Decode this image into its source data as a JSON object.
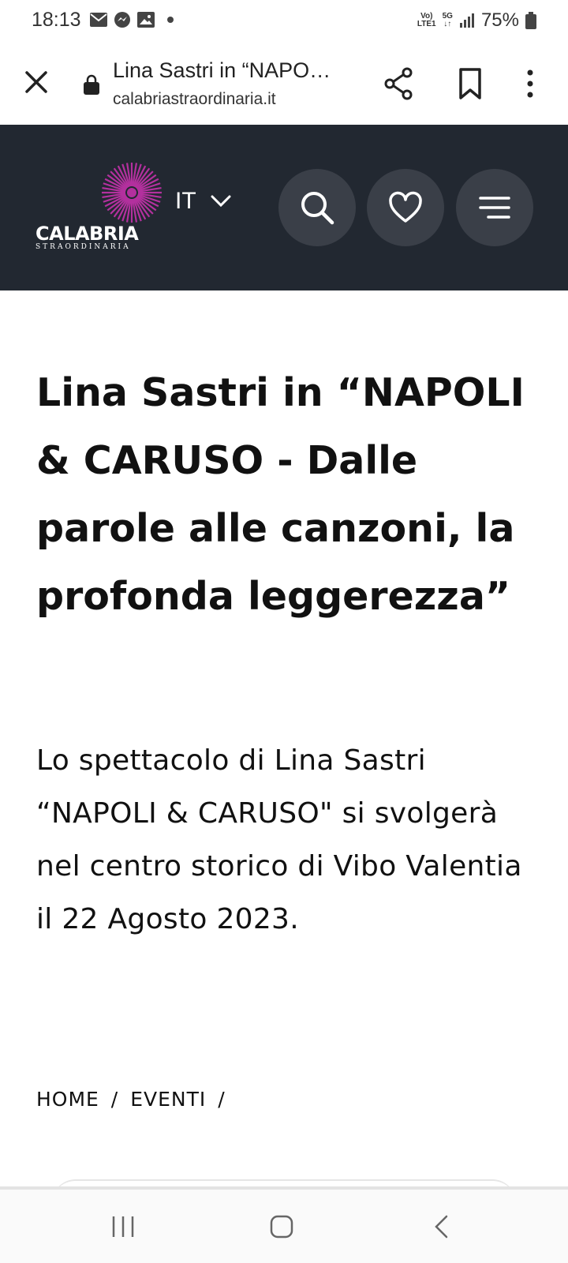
{
  "status_bar": {
    "time": "18:13",
    "network_top": "Vo)",
    "network_bottom": "LTE1",
    "network_5g": "5G",
    "battery": "75%"
  },
  "browser": {
    "title": "Lina Sastri in “NAPO…",
    "url": "calabriastraordinaria.it"
  },
  "site_header": {
    "logo_word": "CALABRIA",
    "logo_sub": "STRAORDINARIA",
    "language": "IT",
    "colors": {
      "background": "#222831",
      "accent": "#b3309e",
      "button": "#3a3f48"
    }
  },
  "article": {
    "title": "Lina Sastri in “NAPOLI & CARUSO - Dalle parole alle canzoni, la profonda leggerezza”",
    "lead": "Lo spettacolo di Lina Sastri “NAPOLI & CARUSO\" si svolgerà nel centro storico di Vibo Valentia il 22 Agosto 2023."
  },
  "breadcrumb": {
    "items": [
      "HOME",
      "EVENTI"
    ],
    "separator": "/"
  }
}
